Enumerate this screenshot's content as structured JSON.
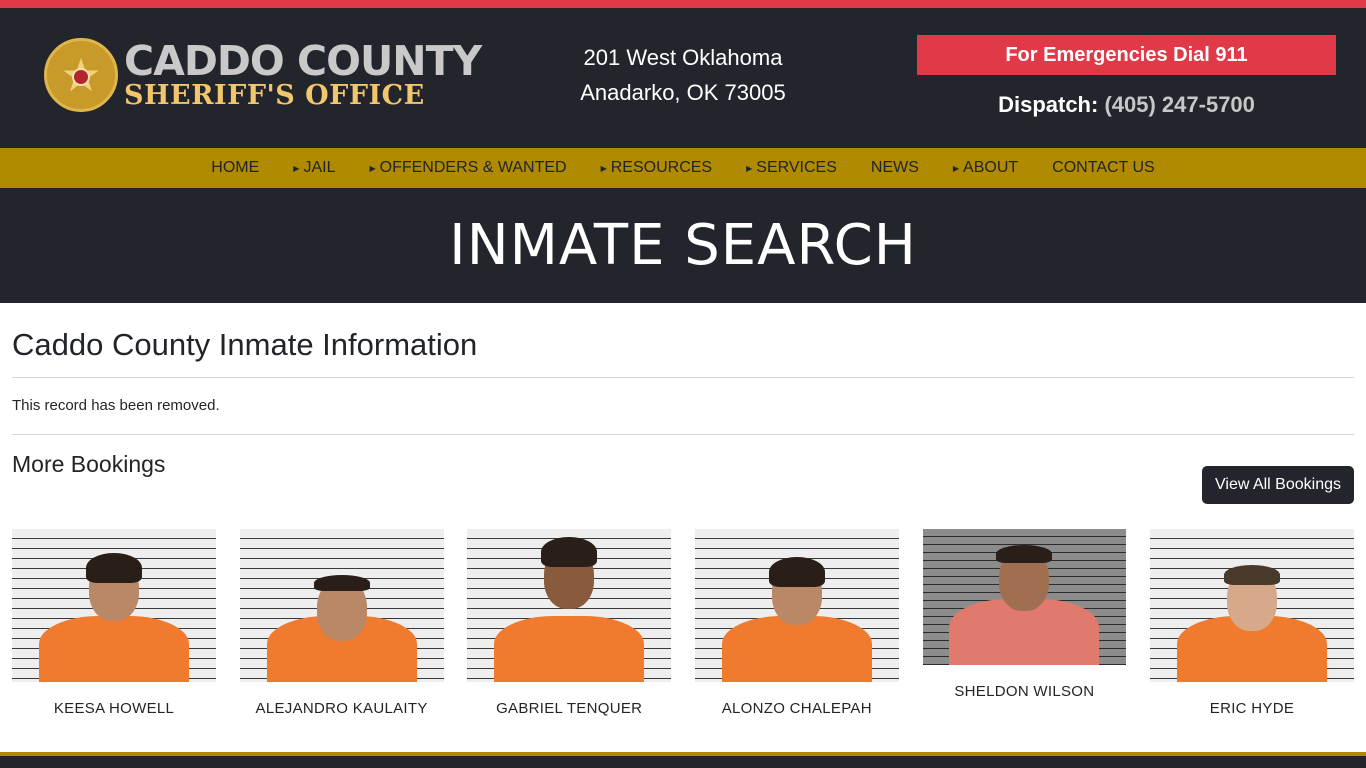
{
  "header": {
    "logo_line1": "CADDO COUNTY",
    "logo_line2": "SHERIFF'S OFFICE",
    "address_line1": "201 West Oklahoma",
    "address_line2": "Anadarko, OK 73005",
    "emergency_label": "For Emergencies Dial 911",
    "dispatch_label": "Dispatch:",
    "dispatch_phone": "(405) 247-5700"
  },
  "nav": {
    "items": [
      {
        "label": "HOME",
        "has_submenu": false
      },
      {
        "label": "JAIL",
        "has_submenu": true
      },
      {
        "label": "OFFENDERS & WANTED",
        "has_submenu": true
      },
      {
        "label": "RESOURCES",
        "has_submenu": true
      },
      {
        "label": "SERVICES",
        "has_submenu": true
      },
      {
        "label": "NEWS",
        "has_submenu": false
      },
      {
        "label": "ABOUT",
        "has_submenu": true
      },
      {
        "label": "CONTACT US",
        "has_submenu": false
      }
    ]
  },
  "banner": {
    "title": "INMATE SEARCH"
  },
  "main": {
    "page_title": "Caddo County Inmate Information",
    "removed_notice": "This record has been removed.",
    "more_title": "More Bookings",
    "view_all_label": "View All Bookings",
    "bookings": [
      {
        "name": "KEESA HOWELL"
      },
      {
        "name": "ALEJANDRO KAULAITY"
      },
      {
        "name": "GABRIEL TENQUER"
      },
      {
        "name": "ALONZO CHALEPAH"
      },
      {
        "name": "SHELDON WILSON"
      },
      {
        "name": "ERIC HYDE"
      }
    ]
  },
  "colors": {
    "accent_red": "#e03a48",
    "nav_gold": "#b08a00",
    "dark": "#22252c"
  }
}
